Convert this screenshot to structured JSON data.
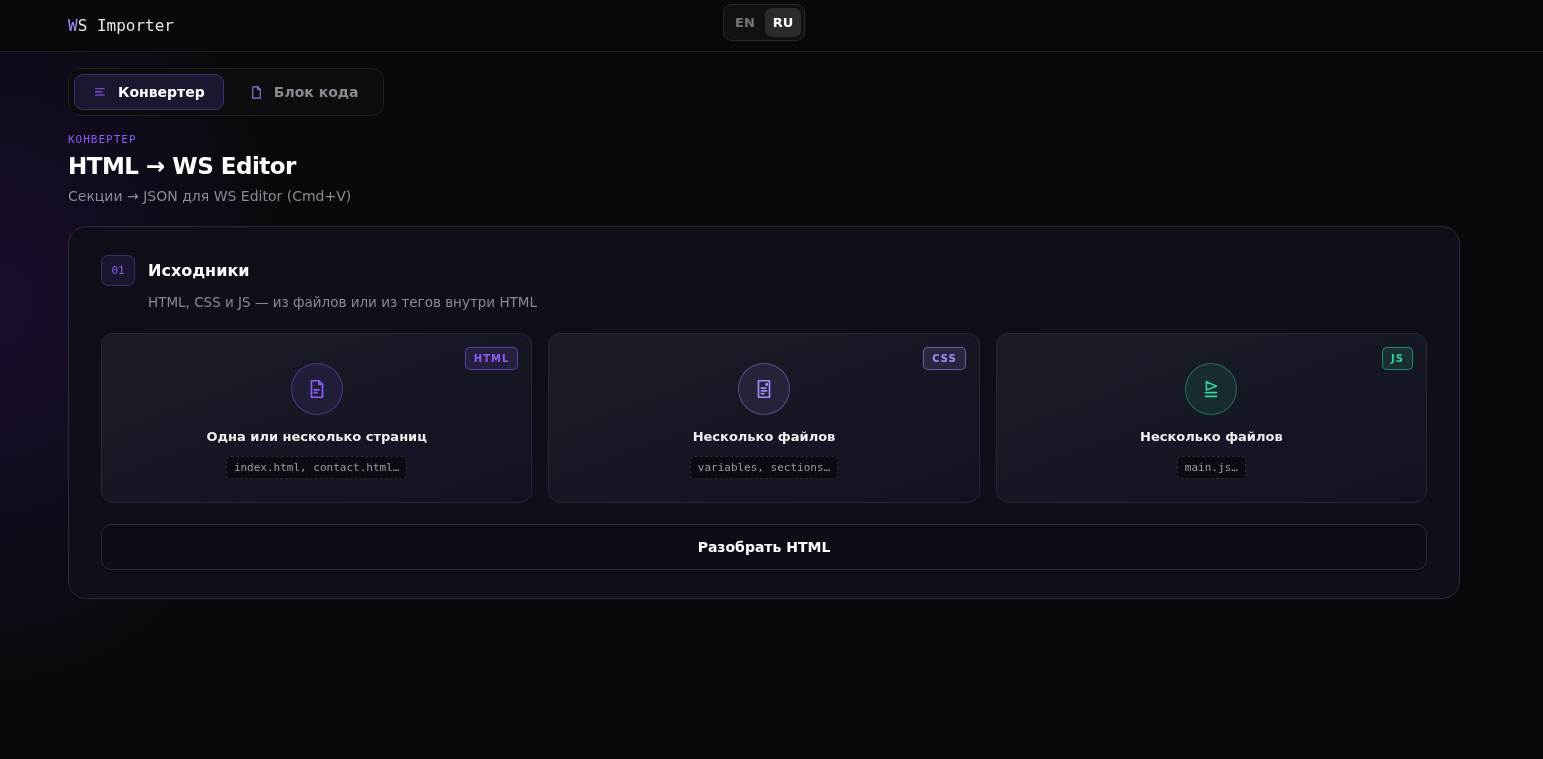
{
  "header": {
    "logo": "WS Importer",
    "languages": [
      {
        "label": "EN",
        "selected": false
      },
      {
        "label": "RU",
        "selected": true
      }
    ]
  },
  "tabs": [
    {
      "label": "Конвертер",
      "kind": "lines",
      "selected": true
    },
    {
      "label": "Блок кода",
      "kind": "file",
      "selected": false
    }
  ],
  "intro": {
    "eyebrow": "КОНВЕРТЕР",
    "title": "HTML → WS Editor",
    "subtitle": "Секции → JSON для WS Editor (Cmd+V)"
  },
  "step": {
    "number": "01",
    "title": "Исходники",
    "description": "HTML, CSS и JS — из файлов или из тегов внутри HTML",
    "sources": [
      {
        "kind": "html",
        "badge": "HTML",
        "color": "#8b5cf6",
        "title": "Одна или несколько страниц",
        "hint": "index.html, contact.html…"
      },
      {
        "kind": "css",
        "badge": "CSS",
        "color": "#a78bfa",
        "title": "Несколько файлов",
        "hint": "variables, sections…"
      },
      {
        "kind": "js",
        "badge": "JS",
        "color": "#34d399",
        "title": "Несколько файлов",
        "hint": "main.js…"
      }
    ],
    "action": "Разобрать HTML"
  }
}
